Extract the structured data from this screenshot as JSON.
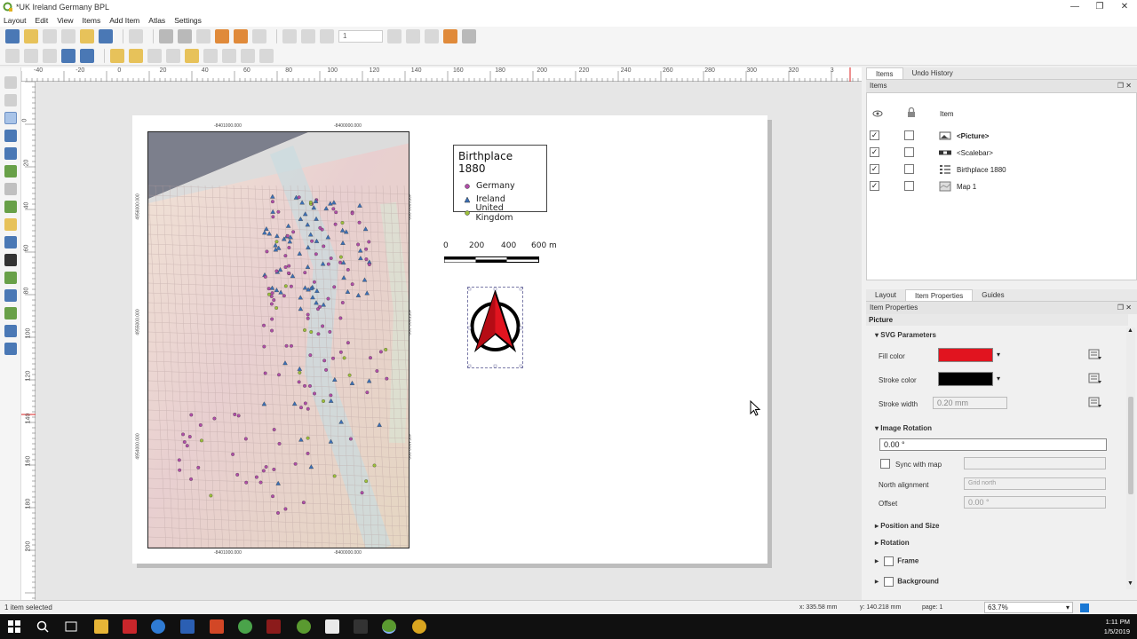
{
  "window": {
    "title": "*UK Ireland Germany BPL",
    "buttons": [
      "—",
      "❐",
      "✕"
    ]
  },
  "menu": [
    "Layout",
    "Edit",
    "View",
    "Items",
    "Add Item",
    "Atlas",
    "Settings"
  ],
  "toolbar": {
    "page_value": "1"
  },
  "ruler_top": [
    "-40",
    "-20",
    "0",
    "20",
    "40",
    "60",
    "80",
    "100",
    "120",
    "140",
    "160",
    "180",
    "200",
    "220",
    "240",
    "260",
    "280",
    "300",
    "320",
    "3"
  ],
  "ruler_left": [
    "0",
    "20",
    "40",
    "60",
    "80",
    "100",
    "120",
    "140",
    "160",
    "180",
    "200"
  ],
  "map": {
    "coord_top": [
      "-8401000.000",
      "-8400000.000"
    ],
    "coord_bottom": [
      "-8401000.000",
      "-8400000.000"
    ],
    "coord_left": [
      "4956000.000",
      "4955000.000",
      "4954000.000"
    ],
    "coord_right": [
      "4956000.000",
      "4955000.000",
      "4954000.000"
    ]
  },
  "legend": {
    "title": "Birthplace 1880",
    "items": [
      {
        "label": "Germany",
        "color": "#b04ea8"
      },
      {
        "label": "Ireland",
        "color": "#3b6fb5"
      },
      {
        "label": "United Kingdom",
        "color": "#9cbf3a"
      }
    ]
  },
  "scalebar": {
    "labels": [
      "0",
      "200",
      "400",
      "600 m"
    ]
  },
  "north_arrow": {
    "fill": "#e1141f",
    "stroke": "#000000"
  },
  "items_panel": {
    "tabs": [
      "Items",
      "Undo History"
    ],
    "header": "Items",
    "column": "Item",
    "rows": [
      {
        "name": "<Picture>",
        "bold": true
      },
      {
        "name": "<Scalebar>",
        "bold": false
      },
      {
        "name": "Birthplace 1880",
        "bold": false
      },
      {
        "name": "Map 1",
        "bold": false
      }
    ]
  },
  "props_panel": {
    "tabs": [
      "Layout",
      "Item Properties",
      "Guides"
    ],
    "header": "Item Properties",
    "item_type": "Picture",
    "svg_section": "SVG Parameters",
    "fill_label": "Fill color",
    "fill_color": "#e1141f",
    "stroke_label": "Stroke color",
    "stroke_color": "#000000",
    "stroke_width_label": "Stroke width",
    "stroke_width_value": "0.20 mm",
    "rotation_section": "Image Rotation",
    "rotation_value": "0.00 °",
    "sync_label": "Sync with map",
    "north_label": "North alignment",
    "north_value": "Grid north",
    "offset_label": "Offset",
    "offset_value": "0.00 °",
    "sections": [
      "Position and Size",
      "Rotation",
      "Frame",
      "Background"
    ]
  },
  "status": {
    "selected": "1 item selected",
    "x": "x: 335.58 mm",
    "y": "y: 140.218 mm",
    "page": "page: 1",
    "zoom": "63.7%"
  },
  "taskbar": {
    "time": "1:11 PM",
    "date": "1/5/2019"
  }
}
